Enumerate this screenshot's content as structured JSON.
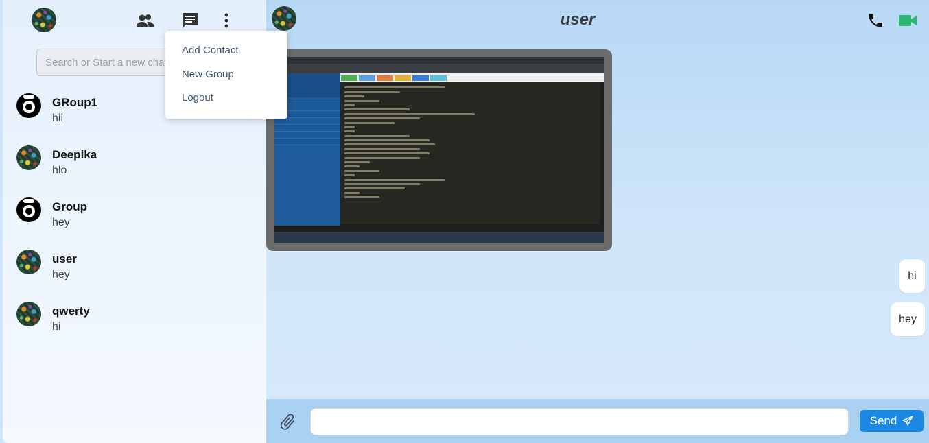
{
  "sidebar": {
    "header_icons": [
      "avatar",
      "contacts-icon",
      "chat-icon",
      "more-vertical-icon"
    ],
    "search": {
      "placeholder": "Search or Start a new chat",
      "value": ""
    },
    "chats": [
      {
        "name": "GRoup1",
        "preview": "hii",
        "avatar": "group"
      },
      {
        "name": "Deepika",
        "preview": "hlo",
        "avatar": "user"
      },
      {
        "name": "Group",
        "preview": "hey",
        "avatar": "group"
      },
      {
        "name": "user",
        "preview": "hey",
        "avatar": "user"
      },
      {
        "name": "qwerty",
        "preview": "hi",
        "avatar": "user"
      }
    ]
  },
  "menu": {
    "items": [
      "Add Contact",
      "New Group",
      "Logout"
    ]
  },
  "conversation": {
    "title": "user",
    "header_icons": [
      "phone-icon",
      "video-call-icon"
    ],
    "messages": [
      {
        "type": "image",
        "description_icon": "screenshot-image"
      },
      {
        "type": "text",
        "text": "hi"
      },
      {
        "type": "text",
        "text": "hey"
      }
    ]
  },
  "composer": {
    "placeholder": "",
    "value": "",
    "send_label": "Send",
    "attach_icon": "paperclip-icon",
    "send_icon": "paper-plane-icon"
  },
  "colors": {
    "accent": "#1d87e4",
    "video_icon": "#2bb673",
    "composer_bg": "#a9d1f1"
  }
}
